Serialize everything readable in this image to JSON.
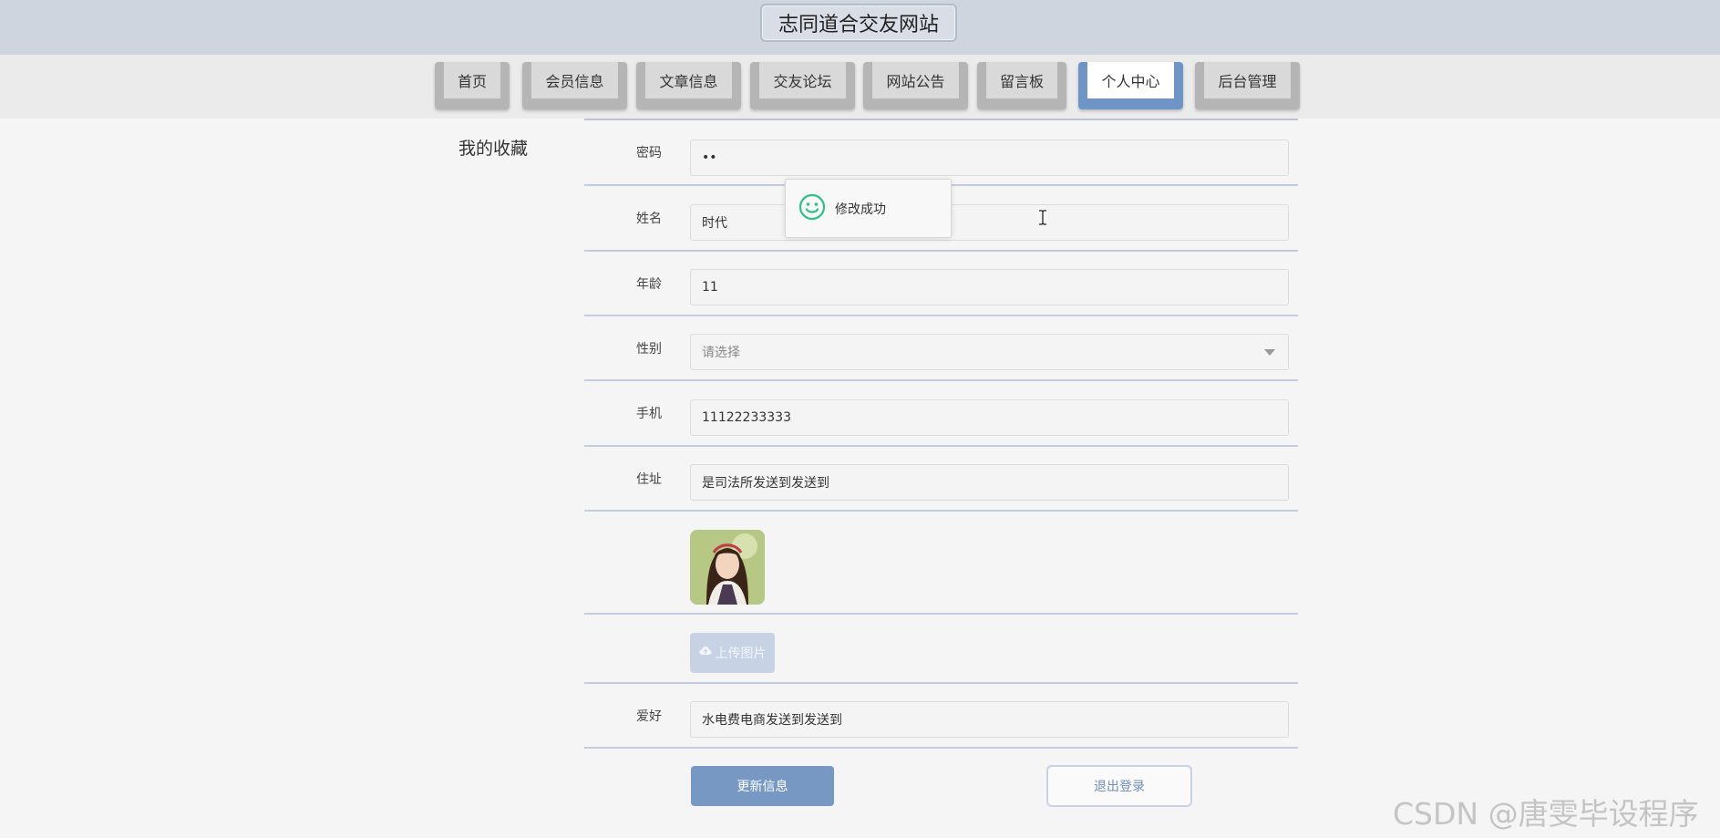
{
  "header": {
    "site_title": "志同道合交友网站"
  },
  "nav": {
    "items": [
      {
        "label": "首页"
      },
      {
        "label": "会员信息"
      },
      {
        "label": "文章信息"
      },
      {
        "label": "交友论坛"
      },
      {
        "label": "网站公告"
      },
      {
        "label": "留言板"
      },
      {
        "label": "个人中心"
      },
      {
        "label": "后台管理"
      }
    ],
    "active": "个人中心"
  },
  "sidebar": {
    "title": "我的收藏"
  },
  "form": {
    "password": {
      "label": "密码",
      "value": "••"
    },
    "name": {
      "label": "姓名",
      "value": "时代"
    },
    "age": {
      "label": "年龄",
      "value": "11"
    },
    "gender": {
      "label": "性别",
      "placeholder": "请选择"
    },
    "phone": {
      "label": "手机",
      "value": "11122233333"
    },
    "address": {
      "label": "住址",
      "value": "是司法所发送到发送到"
    },
    "upload_label": "上传图片",
    "hobby": {
      "label": "爱好",
      "value": "水电费电商发送到发送到"
    },
    "update_button": "更新信息",
    "logout_button": "退出登录"
  },
  "toast": {
    "message": "修改成功",
    "icon": "smile-icon"
  },
  "watermark": "CSDN @唐雯毕设程序",
  "colors": {
    "header_bg": "#cfd5df",
    "nav_active": "#6f95c7",
    "primary": "#7898c4",
    "toast_icon": "#2fbf8a"
  }
}
